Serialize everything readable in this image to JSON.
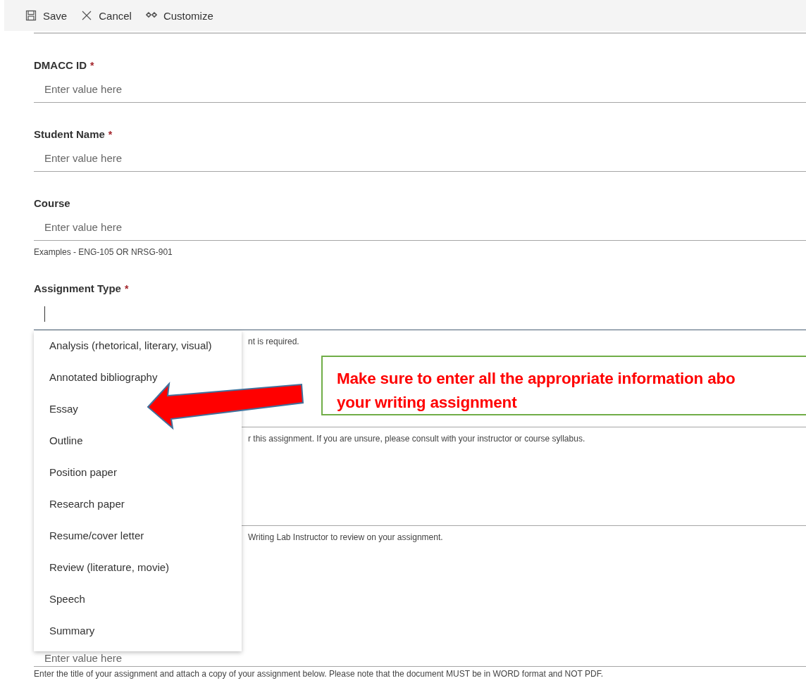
{
  "toolbar": [
    {
      "kind": "save",
      "label": "Save"
    },
    {
      "kind": "cancel",
      "label": "Cancel"
    },
    {
      "kind": "customize",
      "label": "Customize"
    }
  ],
  "fields": [
    {
      "label": "DMACC ID",
      "required_mark": "*",
      "placeholder": "Enter value here"
    },
    {
      "label": "Student Name",
      "required_mark": "*",
      "placeholder": "Enter value here"
    },
    {
      "label": "Course",
      "placeholder": "Enter value here",
      "hint": "Examples - ENG-105 OR NRSG-901"
    },
    {
      "label": "Assignment Type",
      "required_mark": "*",
      "focused": true,
      "hint": "nt is required."
    },
    {
      "hint": "r this assignment. If you are unsure, please consult with your instructor or course syllabus."
    },
    {
      "hint": "Writing Lab Instructor to review on your assignment."
    },
    {
      "placeholder": "Enter value here",
      "hint": "Enter the title of your assignment and attach a copy of your assignment below. Please note that the document MUST be in WORD format and NOT PDF."
    }
  ],
  "dropdown": {
    "options": [
      {
        "label": "Analysis (rhetorical, literary, visual)"
      },
      {
        "label": "Annotated bibliography"
      },
      {
        "label": "Essay"
      },
      {
        "label": "Outline"
      },
      {
        "label": "Position paper"
      },
      {
        "label": "Research paper"
      },
      {
        "label": "Resume/cover letter"
      },
      {
        "label": "Review (literature, movie)"
      },
      {
        "label": "Speech"
      },
      {
        "label": "Summary"
      }
    ]
  },
  "callout": {
    "lines": [
      "Make sure to enter all the appropriate information abo",
      "your writing assignment"
    ]
  }
}
